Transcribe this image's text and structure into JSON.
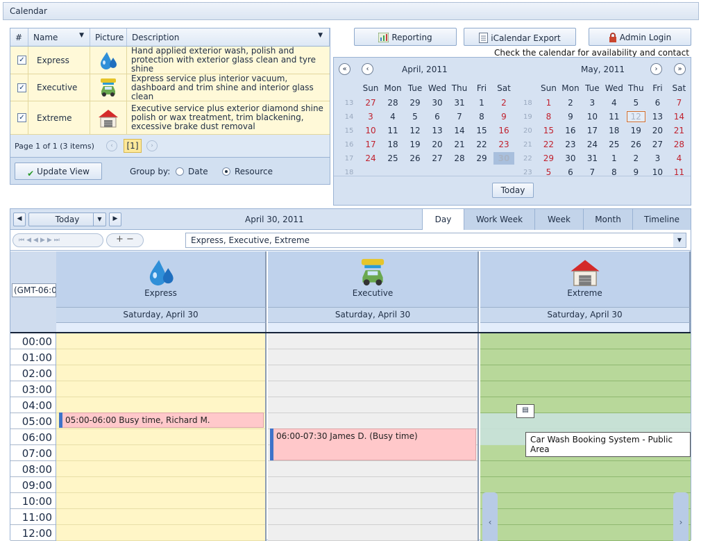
{
  "title": "Calendar",
  "grid": {
    "headers": {
      "select": "#",
      "name": "Name",
      "picture": "Picture",
      "description": "Description"
    },
    "rows": [
      {
        "checked": "✓",
        "name": "Express",
        "icon": "water-drops-icon",
        "desc": "Hand applied exterior wash, polish and protection with exterior glass clean and tyre shine"
      },
      {
        "checked": "✓",
        "name": "Executive",
        "icon": "car-wash-icon",
        "desc": "Express service plus interior vacuum, dashboard and trim shine and interior glass clean"
      },
      {
        "checked": "✓",
        "name": "Extreme",
        "icon": "garage-house-icon",
        "desc": "Executive service plus exterior diamond shine polish or wax treatment, trim blackening, excessive brake dust removal"
      }
    ],
    "pager": {
      "text": "Page 1 of 1 (3 items)",
      "page": "[1]"
    },
    "update": "Update View",
    "groupby": "Group by:",
    "opt_date": "Date",
    "opt_resource": "Resource"
  },
  "buttons": {
    "reporting": "Reporting",
    "icalendar": "iCalendar Export",
    "admin": "Admin Login"
  },
  "notice": "Check the calendar for availability and contact us",
  "mini": {
    "left": {
      "title": "April, 2011",
      "weeks": [
        {
          "w": "13",
          "d": [
            "27",
            "28",
            "29",
            "30",
            "31",
            "1",
            "2"
          ]
        },
        {
          "w": "14",
          "d": [
            "3",
            "4",
            "5",
            "6",
            "7",
            "8",
            "9"
          ]
        },
        {
          "w": "15",
          "d": [
            "10",
            "11",
            "12",
            "13",
            "14",
            "15",
            "16"
          ]
        },
        {
          "w": "16",
          "d": [
            "17",
            "18",
            "19",
            "20",
            "21",
            "22",
            "23"
          ]
        },
        {
          "w": "17",
          "d": [
            "24",
            "25",
            "26",
            "27",
            "28",
            "29",
            "30"
          ]
        },
        {
          "w": "18",
          "d": [
            "",
            "",
            "",
            "",
            "",
            "",
            ""
          ]
        }
      ]
    },
    "right": {
      "title": "May, 2011",
      "weeks": [
        {
          "w": "18",
          "d": [
            "1",
            "2",
            "3",
            "4",
            "5",
            "6",
            "7"
          ]
        },
        {
          "w": "19",
          "d": [
            "8",
            "9",
            "10",
            "11",
            "12",
            "13",
            "14"
          ]
        },
        {
          "w": "20",
          "d": [
            "15",
            "16",
            "17",
            "18",
            "19",
            "20",
            "21"
          ]
        },
        {
          "w": "21",
          "d": [
            "22",
            "23",
            "24",
            "25",
            "26",
            "27",
            "28"
          ]
        },
        {
          "w": "22",
          "d": [
            "29",
            "30",
            "31",
            "1",
            "2",
            "3",
            "4"
          ]
        },
        {
          "w": "23",
          "d": [
            "5",
            "6",
            "7",
            "8",
            "9",
            "10",
            "11"
          ]
        }
      ]
    },
    "dow": [
      "Sun",
      "Mon",
      "Tue",
      "Wed",
      "Thu",
      "Fri",
      "Sat"
    ],
    "today": "Today"
  },
  "sched": {
    "today": "Today",
    "date": "April 30, 2011",
    "views": [
      "Day",
      "Work Week",
      "Week",
      "Month",
      "Timeline"
    ],
    "filter": "Express, Executive, Extreme",
    "tz": "(GMT-06:0",
    "resources": [
      {
        "name": "Express",
        "date": "Saturday, April 30"
      },
      {
        "name": "Executive",
        "date": "Saturday, April 30"
      },
      {
        "name": "Extreme",
        "date": "Saturday, April 30"
      }
    ],
    "hours": [
      "00:00",
      "01:00",
      "02:00",
      "03:00",
      "04:00",
      "05:00",
      "06:00",
      "07:00",
      "08:00",
      "09:00",
      "10:00",
      "11:00",
      "12:00"
    ],
    "appt1": "05:00-06:00 Busy time, Richard M.",
    "appt2": "06:00-07:30 James D. (Busy time)",
    "tooltip": "Car Wash Booking System - Public Area"
  },
  "colors": {
    "express": "#fff6c7",
    "executive": "#efefef",
    "extreme": "#b8d89a",
    "busy": "#ffc8ca",
    "accent": "#3e73c9"
  }
}
